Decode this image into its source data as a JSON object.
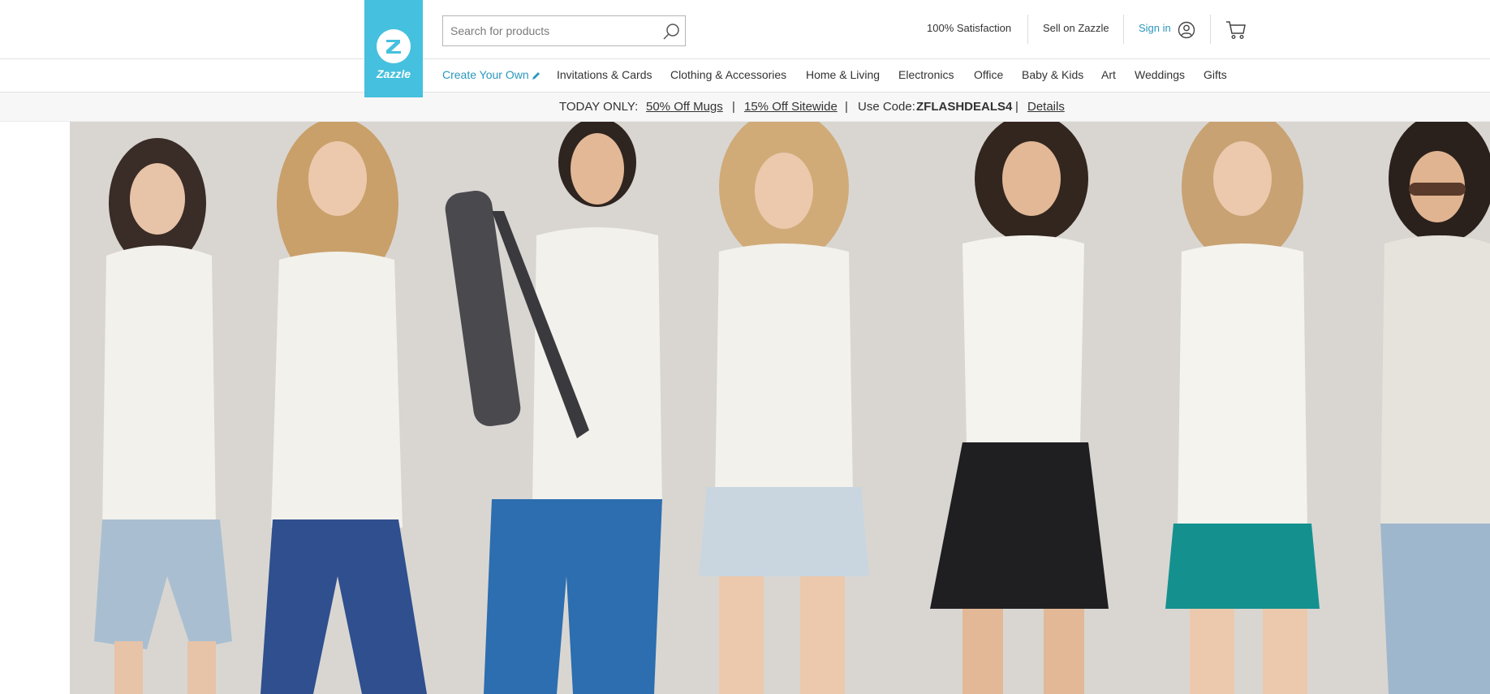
{
  "logo": {
    "text": "Zazzle"
  },
  "search": {
    "placeholder": "Search for products"
  },
  "utility": {
    "satisfaction": "100% Satisfaction",
    "sell": "Sell on Zazzle",
    "sign_in": "Sign in"
  },
  "nav": {
    "items": [
      "Create Your Own",
      "Invitations & Cards",
      "Clothing & Accessories",
      "Home & Living",
      "Electronics",
      "Office",
      "Baby & Kids",
      "Art",
      "Weddings",
      "Gifts"
    ]
  },
  "promo": {
    "label": "TODAY ONLY:",
    "offer_1": "50% Off Mugs",
    "sep": "|",
    "offer_2": "15% Off Sitewide",
    "code_label": "Use Code:",
    "code": "ZFLASHDEALS4",
    "details": "Details"
  },
  "colors": {
    "brand": "#45c0de",
    "link": "#2a97bd",
    "hero_background": "#d9d6d2"
  },
  "icons": [
    "search-icon",
    "user-icon",
    "cart-icon",
    "pencil-icon"
  ]
}
